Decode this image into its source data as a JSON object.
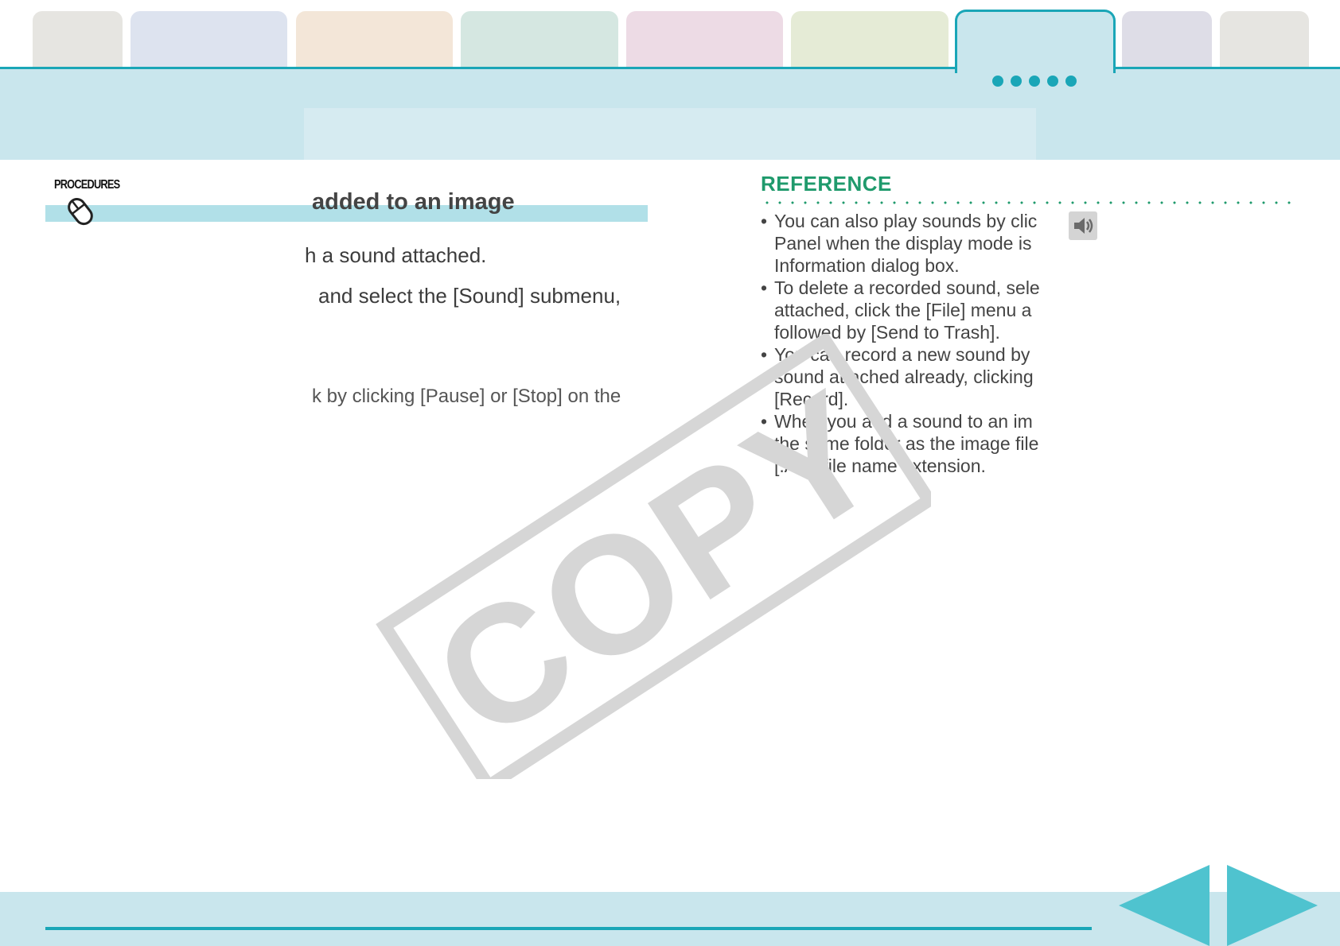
{
  "tabs": [
    {
      "color": "#e6e5e1"
    },
    {
      "color": "#dde3ef"
    },
    {
      "color": "#f3e6d8"
    },
    {
      "color": "#d5e7e1"
    },
    {
      "color": "#eddbe5"
    },
    {
      "color": "#e5ebd6"
    },
    {
      "color": "#c9e6ed",
      "active": true
    },
    {
      "color": "#dedde7"
    },
    {
      "color": "#e6e5e1"
    }
  ],
  "colors": {
    "accent": "#1aa6b7",
    "header_band": "#c9e6ed",
    "reference_green": "#1f9a6c",
    "nav_arrow": "#4fc3cf"
  },
  "procedures": {
    "label": "PROCEDURES",
    "icon": "mouse-icon",
    "title": "added to an image"
  },
  "steps": [
    "h a sound attached.",
    "and select the [Sound] submenu,"
  ],
  "note": "k by clicking [Pause] or [Stop] on the",
  "reference": {
    "title": "REFERENCE",
    "icon": "speaker-icon",
    "items": [
      [
        "You can also play sounds by clic",
        "Panel when the display mode is",
        "Information dialog box."
      ],
      [
        "To delete a recorded sound, sele",
        "attached, click the [File] menu a",
        "followed by [Send to Trash]."
      ],
      [
        "You can record a new sound by",
        "sound attached already, clicking",
        "[Record]."
      ],
      [
        "When you add a sound to an im",
        "the same folder as the image file",
        "[.AIF] file name extension."
      ]
    ]
  },
  "watermark": {
    "text": "COPY"
  },
  "navigation": {
    "prev": "prev-page-arrow-icon",
    "next": "next-page-arrow-icon"
  }
}
